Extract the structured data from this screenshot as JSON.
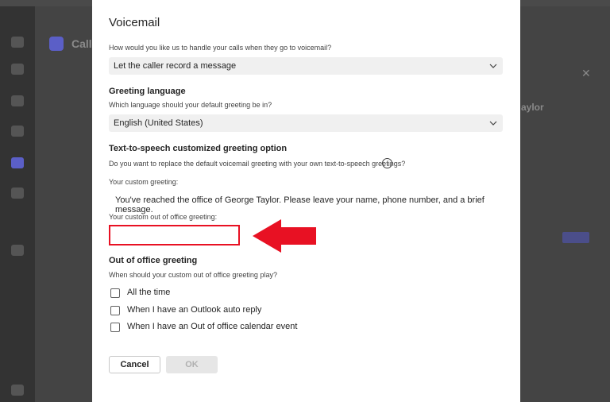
{
  "dialog": {
    "title": "Voicemail",
    "handle_question": "How would you like us to handle your calls when they go to voicemail?",
    "handle_value": "Let the caller record a message",
    "greeting_language_heading": "Greeting language",
    "greeting_language_question": "Which language should your default greeting be in?",
    "greeting_language_value": "English (United States)",
    "tts_heading": "Text-to-speech customized greeting option",
    "tts_question": "Do you want to replace the default voicemail greeting with your own text-to-speech greetings?",
    "info_icon_glyph": "i",
    "custom_greeting_label": "Your custom greeting:",
    "custom_greeting_text": "You've reached the office of George Taylor. Please leave your name, phone number, and a brief message.",
    "custom_ooo_label": "Your custom out of office greeting:",
    "custom_ooo_value": "",
    "ooo_heading": "Out of office greeting",
    "ooo_question": "When should your custom out of office greeting play?",
    "ooo_options": [
      {
        "label": "All the time",
        "checked": false
      },
      {
        "label": "When I have an Outlook auto reply",
        "checked": false
      },
      {
        "label": "When I have an Out of office calendar event",
        "checked": false
      }
    ],
    "cancel_label": "Cancel",
    "ok_label": "OK"
  },
  "background": {
    "calls_title": "Call",
    "contact_name": "aylor",
    "close_glyph": "✕"
  },
  "icons": {
    "chevron": "chevron-down-icon",
    "info": "info-icon",
    "arrow": "red-arrow-annotation"
  },
  "colors": {
    "highlight_red": "#e81123",
    "accent": "#5b5fc7"
  }
}
